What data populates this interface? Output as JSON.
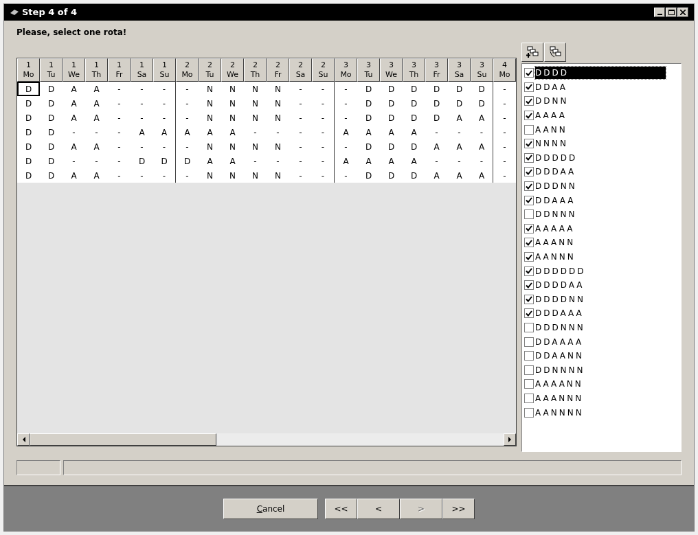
{
  "window": {
    "title": "Step 4 of 4"
  },
  "prompt": "Please, select one rota!",
  "grid": {
    "columns": [
      {
        "week": "1",
        "day": "Mo"
      },
      {
        "week": "1",
        "day": "Tu"
      },
      {
        "week": "1",
        "day": "We"
      },
      {
        "week": "1",
        "day": "Th"
      },
      {
        "week": "1",
        "day": "Fr"
      },
      {
        "week": "1",
        "day": "Sa"
      },
      {
        "week": "1",
        "day": "Su"
      },
      {
        "week": "2",
        "day": "Mo"
      },
      {
        "week": "2",
        "day": "Tu"
      },
      {
        "week": "2",
        "day": "We"
      },
      {
        "week": "2",
        "day": "Th"
      },
      {
        "week": "2",
        "day": "Fr"
      },
      {
        "week": "2",
        "day": "Sa"
      },
      {
        "week": "2",
        "day": "Su"
      },
      {
        "week": "3",
        "day": "Mo"
      },
      {
        "week": "3",
        "day": "Tu"
      },
      {
        "week": "3",
        "day": "We"
      },
      {
        "week": "3",
        "day": "Th"
      },
      {
        "week": "3",
        "day": "Fr"
      },
      {
        "week": "3",
        "day": "Sa"
      },
      {
        "week": "3",
        "day": "Su"
      },
      {
        "week": "4",
        "day": "Mo"
      }
    ],
    "rows": [
      {
        "selected": true,
        "cells": [
          "D",
          "D",
          "A",
          "A",
          "-",
          "-",
          "-",
          "-",
          "N",
          "N",
          "N",
          "N",
          "-",
          "-",
          "-",
          "D",
          "D",
          "D",
          "D",
          "D",
          "D",
          "-"
        ]
      },
      {
        "selected": false,
        "cells": [
          "D",
          "D",
          "A",
          "A",
          "-",
          "-",
          "-",
          "-",
          "N",
          "N",
          "N",
          "N",
          "-",
          "-",
          "-",
          "D",
          "D",
          "D",
          "D",
          "D",
          "D",
          "-"
        ]
      },
      {
        "selected": false,
        "cells": [
          "D",
          "D",
          "A",
          "A",
          "-",
          "-",
          "-",
          "-",
          "N",
          "N",
          "N",
          "N",
          "-",
          "-",
          "-",
          "D",
          "D",
          "D",
          "D",
          "A",
          "A",
          "-"
        ]
      },
      {
        "selected": false,
        "cells": [
          "D",
          "D",
          "-",
          "-",
          "-",
          "A",
          "A",
          "A",
          "A",
          "A",
          "-",
          "-",
          "-",
          "-",
          "A",
          "A",
          "A",
          "A",
          "-",
          "-",
          "-",
          "-"
        ]
      },
      {
        "selected": false,
        "cells": [
          "D",
          "D",
          "A",
          "A",
          "-",
          "-",
          "-",
          "-",
          "N",
          "N",
          "N",
          "N",
          "-",
          "-",
          "-",
          "D",
          "D",
          "D",
          "A",
          "A",
          "A",
          "-"
        ]
      },
      {
        "selected": false,
        "cells": [
          "D",
          "D",
          "-",
          "-",
          "-",
          "D",
          "D",
          "D",
          "A",
          "A",
          "-",
          "-",
          "-",
          "-",
          "A",
          "A",
          "A",
          "A",
          "-",
          "-",
          "-",
          "-"
        ]
      },
      {
        "selected": false,
        "cells": [
          "D",
          "D",
          "A",
          "A",
          "-",
          "-",
          "-",
          "-",
          "N",
          "N",
          "N",
          "N",
          "-",
          "-",
          "-",
          "D",
          "D",
          "D",
          "A",
          "A",
          "A",
          "-"
        ]
      }
    ]
  },
  "patterns": [
    {
      "label": "DDDD",
      "checked": true,
      "selected": true
    },
    {
      "label": "DDAA",
      "checked": true,
      "selected": false
    },
    {
      "label": "DDNN",
      "checked": true,
      "selected": false
    },
    {
      "label": "AAAA",
      "checked": true,
      "selected": false
    },
    {
      "label": "AANN",
      "checked": false,
      "selected": false
    },
    {
      "label": "NNNN",
      "checked": true,
      "selected": false
    },
    {
      "label": "DDDDD",
      "checked": true,
      "selected": false
    },
    {
      "label": "DDDAA",
      "checked": true,
      "selected": false
    },
    {
      "label": "DDDNN",
      "checked": true,
      "selected": false
    },
    {
      "label": "DDAAA",
      "checked": true,
      "selected": false
    },
    {
      "label": "DDNNN",
      "checked": false,
      "selected": false
    },
    {
      "label": "AAAAA",
      "checked": true,
      "selected": false
    },
    {
      "label": "AAANN",
      "checked": true,
      "selected": false
    },
    {
      "label": "AANNN",
      "checked": true,
      "selected": false
    },
    {
      "label": "DDDDDD",
      "checked": true,
      "selected": false
    },
    {
      "label": "DDDDAA",
      "checked": true,
      "selected": false
    },
    {
      "label": "DDDDNN",
      "checked": true,
      "selected": false
    },
    {
      "label": "DDDAAA",
      "checked": true,
      "selected": false
    },
    {
      "label": "DDDNNN",
      "checked": false,
      "selected": false
    },
    {
      "label": "DDAAAA",
      "checked": false,
      "selected": false
    },
    {
      "label": "DDAANN",
      "checked": false,
      "selected": false
    },
    {
      "label": "DDNNNN",
      "checked": false,
      "selected": false
    },
    {
      "label": "AAAANN",
      "checked": false,
      "selected": false
    },
    {
      "label": "AAANNN",
      "checked": false,
      "selected": false
    },
    {
      "label": "AANNNN",
      "checked": false,
      "selected": false
    }
  ],
  "buttons": [
    {
      "label": "Cancel",
      "kind": "cancel",
      "disabled": false
    },
    {
      "label": "<<",
      "kind": "nav",
      "disabled": false
    },
    {
      "label": "<",
      "kind": "nav",
      "disabled": false
    },
    {
      "label": ">",
      "kind": "nav",
      "disabled": true
    },
    {
      "label": ">>",
      "kind": "nav",
      "disabled": false
    }
  ]
}
